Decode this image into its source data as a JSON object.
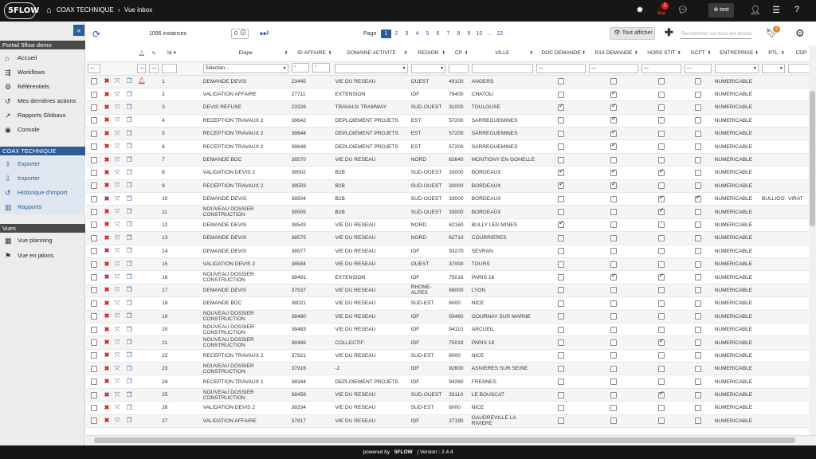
{
  "topbar": {
    "logo": "5FLOW",
    "crumb1": "COAX TECHNIQUE",
    "crumb_sep": "›",
    "crumb2": "Vue inbox",
    "notif_count": "1",
    "user": "test"
  },
  "sidebar": {
    "portal_title": "Portail 5flow demo",
    "portal_items": [
      {
        "label": "Accueil",
        "icon": "home-icon"
      },
      {
        "label": "Workflows",
        "icon": "workflow-icon"
      },
      {
        "label": "Référentiels",
        "icon": "gear-icon"
      },
      {
        "label": "Mes dernières actions",
        "icon": "history-icon"
      },
      {
        "label": "Rapports Globaux",
        "icon": "chart-icon"
      },
      {
        "label": "Console",
        "icon": "console-icon"
      }
    ],
    "coax_title": "COAX TECHNIQUE",
    "coax_items": [
      {
        "label": "Exporter",
        "icon": "export-icon"
      },
      {
        "label": "Importer",
        "icon": "import-icon"
      },
      {
        "label": "Historique d'import",
        "icon": "history-icon"
      },
      {
        "label": "Rapports",
        "icon": "chart-icon"
      }
    ],
    "views_title": "Vues",
    "views_items": [
      {
        "label": "Vue planning",
        "icon": "calendar-icon"
      },
      {
        "label": "Vue en jalons",
        "icon": "flag-icon"
      }
    ]
  },
  "toolbar": {
    "instances": "1096 instances",
    "selected_count": "0",
    "page_label": "Page",
    "pages": [
      "1",
      "2",
      "3",
      "4",
      "5",
      "6",
      "7",
      "8",
      "9",
      "10",
      "...",
      "22"
    ],
    "active_page": "1",
    "show_all": "Tout afficher",
    "search_placeholder": "Rechercher sur tous les dossiers",
    "bookmark_count": "2"
  },
  "columns": [
    "",
    "",
    "",
    "",
    "Id",
    "",
    "Etape",
    "ID AFFAIRE",
    "DOMAINE ACTIVITE",
    "REGION",
    "CP",
    "VILLE",
    "DOC DEMANDE",
    "R13 DEMANDE",
    "HORS STIT",
    "GCFT",
    "ENTREPRISE",
    "RTL",
    "CDP"
  ],
  "filters": {
    "etape": "Sélection...",
    "id_affaire_op1": "⁼",
    "id_affaire_op2": "⁼"
  },
  "rows": [
    {
      "id": "1",
      "alert": true,
      "etape": "DEMANDE DEVIS",
      "affaire": "23445",
      "domaine": "VIE DU RESEAU",
      "region": "OUEST",
      "cp": "49100",
      "ville": "ANGERS",
      "doc": false,
      "r13": false,
      "hors": false,
      "gcft": false,
      "entreprise": "NUMERICABLE",
      "rtl": "",
      "cdp": ""
    },
    {
      "id": "2",
      "alert": false,
      "etape": "VALIDATION AFFAIRE",
      "affaire": "27711",
      "domaine": "EXTENSION",
      "region": "IDF",
      "cp": "78400",
      "ville": "CHATOU",
      "doc": false,
      "r13": true,
      "hors": false,
      "gcft": false,
      "entreprise": "NUMERICABLE",
      "rtl": "",
      "cdp": ""
    },
    {
      "id": "3",
      "alert": false,
      "etape": "DEVIS REFUSE",
      "affaire": "23326",
      "domaine": "TRAVAUX TRAMWAY",
      "region": "SUD-OUEST",
      "cp": "31000",
      "ville": "TOULOUSE",
      "doc": true,
      "r13": true,
      "hors": false,
      "gcft": false,
      "entreprise": "NUMERICABLE",
      "rtl": "",
      "cdp": ""
    },
    {
      "id": "4",
      "alert": false,
      "etape": "RECEPTION TRAVAUX 2",
      "affaire": "38642",
      "domaine": "DEPLOIEMENT PROJETS",
      "region": "EST",
      "cp": "57200",
      "ville": "SARREGUEMINES",
      "doc": false,
      "r13": true,
      "hors": false,
      "gcft": false,
      "entreprise": "NUMERICABLE",
      "rtl": "",
      "cdp": ""
    },
    {
      "id": "5",
      "alert": false,
      "etape": "RECEPTION TRAVAUX 2",
      "affaire": "38644",
      "domaine": "DEPLOIEMENT PROJETS",
      "region": "EST",
      "cp": "57200",
      "ville": "SARREGUEMINES",
      "doc": false,
      "r13": true,
      "hors": false,
      "gcft": false,
      "entreprise": "NUMERICABLE",
      "rtl": "",
      "cdp": ""
    },
    {
      "id": "6",
      "alert": false,
      "etape": "RECEPTION TRAVAUX 2",
      "affaire": "38648",
      "domaine": "DEPLOIEMENT PROJETS",
      "region": "EST",
      "cp": "57200",
      "ville": "SARREGUEMINES",
      "doc": false,
      "r13": true,
      "hors": false,
      "gcft": false,
      "entreprise": "NUMERICABLE",
      "rtl": "",
      "cdp": ""
    },
    {
      "id": "7",
      "alert": false,
      "etape": "DEMANDE BDC",
      "affaire": "38570",
      "domaine": "VIE DU RESEAU",
      "region": "NORD",
      "cp": "62640",
      "ville": "MONTIGNY EN GOHELLE",
      "doc": false,
      "r13": false,
      "hors": false,
      "gcft": false,
      "entreprise": "NUMERICABLE",
      "rtl": "",
      "cdp": ""
    },
    {
      "id": "8",
      "alert": false,
      "etape": "VALIDATION DEVIS 2",
      "affaire": "38502",
      "domaine": "B2B",
      "region": "SUD-OUEST",
      "cp": "33000",
      "ville": "BORDEAUX",
      "doc": true,
      "r13": true,
      "hors": true,
      "gcft": false,
      "entreprise": "NUMERICABLE",
      "rtl": "",
      "cdp": ""
    },
    {
      "id": "9",
      "alert": false,
      "etape": "RECEPTION TRAVAUX 2",
      "affaire": "38503",
      "domaine": "B2B",
      "region": "SUD-OUEST",
      "cp": "33000",
      "ville": "BORDEAUX",
      "doc": true,
      "r13": true,
      "hors": false,
      "gcft": false,
      "entreprise": "NUMERICABLE",
      "rtl": "",
      "cdp": ""
    },
    {
      "id": "10",
      "alert": false,
      "etape": "DEMANDE DEVIS",
      "affaire": "38504",
      "domaine": "B2B",
      "region": "SUD-OUEST",
      "cp": "33000",
      "ville": "BORDEAUX",
      "doc": false,
      "r13": false,
      "hors": true,
      "gcft": true,
      "entreprise": "NUMERICABLE",
      "rtl": "BULLIOO",
      "cdp": "VIRAT"
    },
    {
      "id": "11",
      "alert": false,
      "etape": "NOUVEAU DOSSIER CONSTRUCTION",
      "affaire": "38505",
      "domaine": "B2B",
      "region": "SUD-OUEST",
      "cp": "33000",
      "ville": "BORDEAUX",
      "doc": false,
      "r13": false,
      "hors": true,
      "gcft": false,
      "entreprise": "NUMERICABLE",
      "rtl": "",
      "cdp": ""
    },
    {
      "id": "12",
      "alert": false,
      "etape": "DEMANDE DEVIS",
      "affaire": "38543",
      "domaine": "VIE DU RESEAU",
      "region": "NORD",
      "cp": "62160",
      "ville": "BULLY LES MINES",
      "doc": true,
      "r13": false,
      "hors": false,
      "gcft": false,
      "entreprise": "NUMERICABLE",
      "rtl": "",
      "cdp": ""
    },
    {
      "id": "13",
      "alert": false,
      "etape": "DEMANDE DEVIS",
      "affaire": "38575",
      "domaine": "VIE DU RESEAU",
      "region": "NORD",
      "cp": "62710",
      "ville": "COURRIERES",
      "doc": false,
      "r13": false,
      "hors": false,
      "gcft": false,
      "entreprise": "NUMERICABLE",
      "rtl": "",
      "cdp": ""
    },
    {
      "id": "14",
      "alert": false,
      "etape": "DEMANDE DEVIS",
      "affaire": "38577",
      "domaine": "VIE DU RESEAU",
      "region": "IDF",
      "cp": "93270",
      "ville": "SEVRAN",
      "doc": false,
      "r13": false,
      "hors": false,
      "gcft": false,
      "entreprise": "NUMERICABLE",
      "rtl": "",
      "cdp": ""
    },
    {
      "id": "15",
      "alert": false,
      "etape": "VALIDATION DEVIS 2",
      "affaire": "38584",
      "domaine": "VIE DU RESEAU",
      "region": "OUEST",
      "cp": "37000",
      "ville": "TOURS",
      "doc": false,
      "r13": false,
      "hors": false,
      "gcft": false,
      "entreprise": "NUMERICABLE",
      "rtl": "",
      "cdp": ""
    },
    {
      "id": "16",
      "alert": false,
      "etape": "NOUVEAU DOSSIER CONSTRUCTION",
      "affaire": "38491",
      "domaine": "EXTENSION",
      "region": "IDF",
      "cp": "75016",
      "ville": "PARIS 16",
      "doc": false,
      "r13": true,
      "hors": true,
      "gcft": false,
      "entreprise": "NUMERICABLE",
      "rtl": "",
      "cdp": ""
    },
    {
      "id": "17",
      "alert": false,
      "etape": "DEMANDE DEVIS",
      "affaire": "37537",
      "domaine": "VIE DU RESEAU",
      "region": "RHONE-ALPES",
      "cp": "69000",
      "ville": "LYON",
      "doc": false,
      "r13": false,
      "hors": false,
      "gcft": false,
      "entreprise": "NUMERICABLE",
      "rtl": "",
      "cdp": ""
    },
    {
      "id": "18",
      "alert": false,
      "etape": "DEMANDE BDC",
      "affaire": "38021",
      "domaine": "VIE DU RESEAU",
      "region": "SUD-EST",
      "cp": "6000",
      "ville": "NICE",
      "doc": false,
      "r13": false,
      "hors": false,
      "gcft": false,
      "entreprise": "NUMERICABLE",
      "rtl": "",
      "cdp": ""
    },
    {
      "id": "19",
      "alert": false,
      "etape": "NOUVEAU DOSSIER CONSTRUCTION",
      "affaire": "38480",
      "domaine": "VIE DU RESEAU",
      "region": "IDF",
      "cp": "93460",
      "ville": "GOURNAY SUR MARNE",
      "doc": false,
      "r13": false,
      "hors": false,
      "gcft": false,
      "entreprise": "NUMERICABLE",
      "rtl": "",
      "cdp": ""
    },
    {
      "id": "20",
      "alert": false,
      "etape": "NOUVEAU DOSSIER CONSTRUCTION",
      "affaire": "38483",
      "domaine": "VIE DU RESEAU",
      "region": "IDF",
      "cp": "94110",
      "ville": "ARCUEIL",
      "doc": false,
      "r13": false,
      "hors": false,
      "gcft": false,
      "entreprise": "NUMERICABLE",
      "rtl": "",
      "cdp": ""
    },
    {
      "id": "21",
      "alert": false,
      "etape": "NOUVEAU DOSSIER CONSTRUCTION",
      "affaire": "38486",
      "domaine": "COLLECTIF",
      "region": "IDF",
      "cp": "75019",
      "ville": "PARIS 19",
      "doc": false,
      "r13": false,
      "hors": true,
      "gcft": false,
      "entreprise": "NUMERICABLE",
      "rtl": "",
      "cdp": ""
    },
    {
      "id": "22",
      "alert": false,
      "etape": "RECEPTION TRAVAUX 2",
      "affaire": "37821",
      "domaine": "VIE DU RESEAU",
      "region": "SUD-EST",
      "cp": "6000",
      "ville": "NICE",
      "doc": false,
      "r13": false,
      "hors": false,
      "gcft": false,
      "entreprise": "NUMERICABLE",
      "rtl": "",
      "cdp": ""
    },
    {
      "id": "23",
      "alert": false,
      "etape": "NOUVEAU DOSSIER CONSTRUCTION",
      "affaire": "37916",
      "domaine": "-2",
      "region": "IDF",
      "cp": "92600",
      "ville": "ASNIERES SUR SEINE",
      "doc": false,
      "r13": false,
      "hors": false,
      "gcft": false,
      "entreprise": "NUMERICABLE",
      "rtl": "",
      "cdp": ""
    },
    {
      "id": "24",
      "alert": false,
      "etape": "RECEPTION TRAVAUX 1",
      "affaire": "38344",
      "domaine": "DEPLOIEMENT PROJETS",
      "region": "IDF",
      "cp": "94260",
      "ville": "FRESNES",
      "doc": false,
      "r13": false,
      "hors": false,
      "gcft": false,
      "entreprise": "NUMERICABLE",
      "rtl": "",
      "cdp": ""
    },
    {
      "id": "25",
      "alert": false,
      "etape": "NOUVEAU DOSSIER CONSTRUCTION",
      "affaire": "38458",
      "domaine": "VIE DU RESEAU",
      "region": "SUD-OUEST",
      "cp": "33110",
      "ville": "LE BOUSCAT",
      "doc": false,
      "r13": false,
      "hors": true,
      "gcft": false,
      "entreprise": "NUMERICABLE",
      "rtl": "",
      "cdp": ""
    },
    {
      "id": "26",
      "alert": false,
      "etape": "VALIDATION DEVIS 2",
      "affaire": "38334",
      "domaine": "VIE DU RESEAU",
      "region": "SUD-EST",
      "cp": "6000",
      "ville": "NICE",
      "doc": false,
      "r13": false,
      "hors": false,
      "gcft": false,
      "entreprise": "NUMERICABLE",
      "rtl": "",
      "cdp": ""
    },
    {
      "id": "27",
      "alert": false,
      "etape": "VALIDATION AFFAIRE",
      "affaire": "37817",
      "domaine": "VIE DU RESEAU",
      "region": "IDF",
      "cp": "27190",
      "ville": "GAUDREVILLE LA RIVIERE",
      "doc": false,
      "r13": false,
      "hors": false,
      "gcft": false,
      "entreprise": "NUMERICABLE",
      "rtl": "",
      "cdp": ""
    }
  ],
  "footer": {
    "powered": "powered by",
    "logo": "5FLOW",
    "version": "| Version : 2.4.4"
  },
  "colors": {
    "topbar": "#161616",
    "accent": "#2e5b9a",
    "delete": "#d81b1b"
  }
}
